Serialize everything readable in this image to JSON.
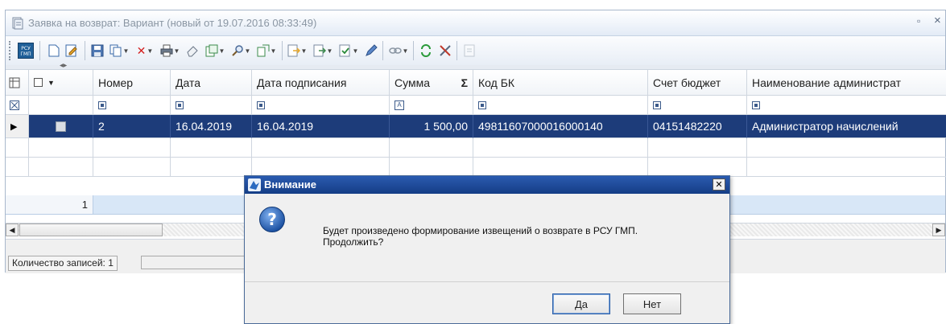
{
  "window": {
    "title": "Заявка на возврат: Вариант (новый от 19.07.2016 08:33:49)",
    "restore_glyph": "▫",
    "close_glyph": "×"
  },
  "toolbar": {
    "rsu_badge": "РСУ ГМП"
  },
  "grid": {
    "columns": [
      "Номер",
      "Дата",
      "Дата подписания",
      "Сумма",
      "Код БК",
      "Счет бюджет",
      "Наименование администрат"
    ],
    "sum_symbol": "Σ",
    "filter_text_icon": "A",
    "rows": [
      {
        "number": "2",
        "date": "16.04.2019",
        "sign_date": "16.04.2019",
        "sum": "1 500,00",
        "kbk": "49811607000016000140",
        "account": "04151482220",
        "admin_name": "Администратор начислений"
      }
    ],
    "record_count": "1"
  },
  "status": {
    "records_label": "Количество записей: 1"
  },
  "dialog": {
    "title": "Внимание",
    "message_line1": "Будет произведено формирование извещений о возврате в РСУ ГМП.",
    "message_line2": "Продолжить?",
    "yes_label": "Да",
    "no_label": "Нет"
  }
}
